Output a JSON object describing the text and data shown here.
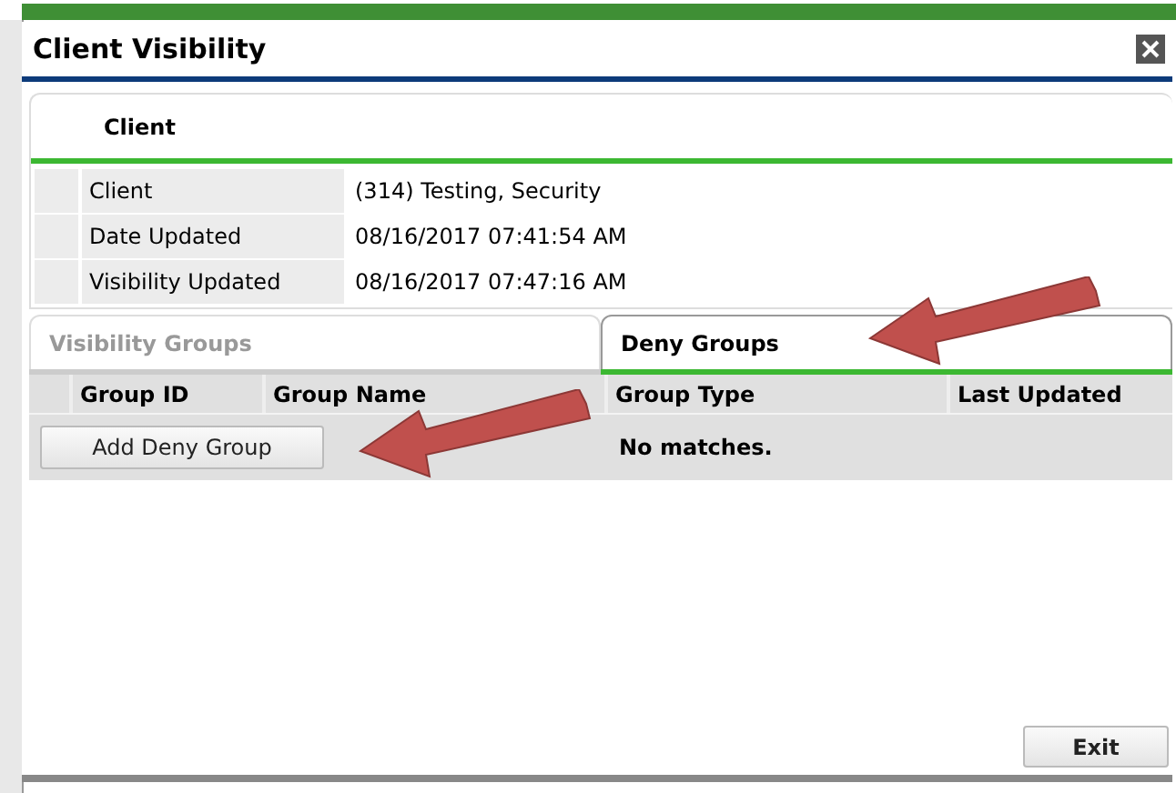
{
  "window": {
    "title": "Client Visibility"
  },
  "client_section": {
    "title": "Client",
    "rows": [
      {
        "label": "Client",
        "value": "(314) Testing, Security"
      },
      {
        "label": "Date Updated",
        "value": "08/16/2017 07:41:54 AM"
      },
      {
        "label": "Visibility Updated",
        "value": "08/16/2017 07:47:16 AM"
      }
    ]
  },
  "tabs": [
    {
      "label": "Visibility Groups",
      "selected": false
    },
    {
      "label": "Deny Groups",
      "selected": true
    }
  ],
  "table": {
    "columns": [
      "Group ID",
      "Group Name",
      "Group Type",
      "Last Updated"
    ],
    "empty_message": "No matches."
  },
  "add_button": "Add Deny Group",
  "exit_button": "Exit"
}
